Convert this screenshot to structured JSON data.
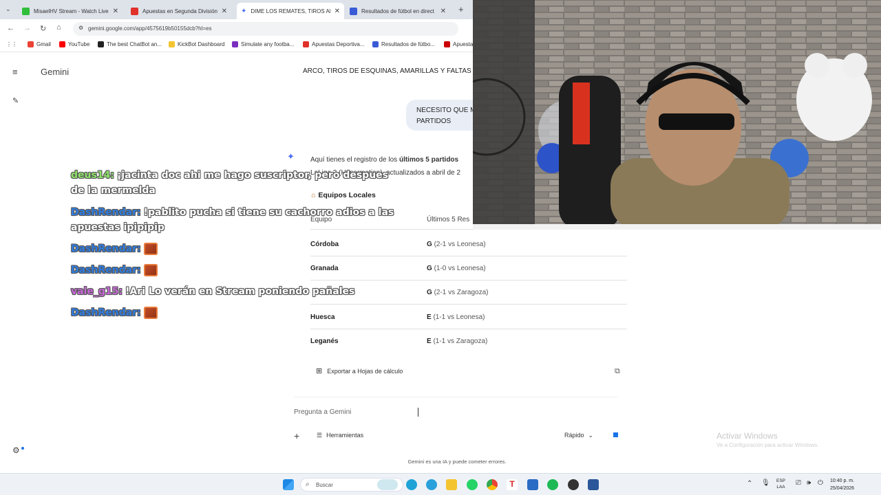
{
  "browser": {
    "tabs": [
      {
        "title": "MisaelHV Stream - Watch Live",
        "color": "#2fbf3a"
      },
      {
        "title": "Apuestas en Segunda División",
        "color": "#e0312b"
      },
      {
        "title": "DIME LOS REMATES, TIROS AL",
        "color": "#4b6ef5"
      },
      {
        "title": "Resultados de fútbol en direct",
        "color": "#3a5bd6"
      }
    ],
    "url": "gemini.google.com/app/4575619b50155dcb?hl=es",
    "bookmarks": [
      "Gmail",
      "YouTube",
      "The best ChatBot an...",
      "KickBot Dashboard",
      "Simulate any footba...",
      "Apuestas Deportiva...",
      "Resultados de fútbo...",
      "Apuesta"
    ]
  },
  "gemini": {
    "title": "Gemini",
    "prompt_strip": "ARCO, TIROS DE ESQUINAS, AMARILLAS Y FALTAS",
    "user_bubble": [
      "NECESITO QUE M",
      "PARTIDOS"
    ],
    "answer_intro_1": "Aquí tienes el registro de los ",
    "answer_intro_bold": "últimos 5 partidos",
    "answer_intro_2": "LaLiga 2 (Hypermotion), actualizados a abril de 2",
    "section_title": "Equipos Locales",
    "table_headers": [
      "Equipo",
      "Últimos 5 Res"
    ],
    "rows": [
      {
        "team": "Córdoba",
        "code": "G",
        "detail": "(2-1 vs Leonesa)"
      },
      {
        "team": "Granada",
        "code": "G",
        "detail": "(1-0 vs Leonesa)"
      },
      {
        "team": "",
        "code": "G",
        "detail": "(2-1 vs Zaragoza)"
      },
      {
        "team": "Huesca",
        "code": "E",
        "detail": "(1-1 vs Leonesa)"
      },
      {
        "team": "Leganés",
        "code": "E",
        "detail": "(1-1 vs Zaragoza)"
      }
    ],
    "export_label": "Exportar a Hojas de cálculo",
    "ask_placeholder": "Pregunta a Gemini",
    "tools_label": "Herramientas",
    "mode_label": "Rápido",
    "disclaimer": "Gemini es una IA y puede cometer errores."
  },
  "chat": [
    {
      "user": "deus14:",
      "color": "#8fe36a",
      "message": "¡jacinta doc ahi me hago suscriptor, pero despues de la mermelda"
    },
    {
      "user": "DashRendar:",
      "color": "#2f7de1",
      "message": "!pablito pucha si tiene su cachorro adios a las apuestas ipipipip"
    },
    {
      "user": "DashRendar:",
      "color": "#2f7de1",
      "message": ""
    },
    {
      "user": "DashRendar:",
      "color": "#2f7de1",
      "message": ""
    },
    {
      "user": "vale_g15:",
      "color": "#c86ad8",
      "message": "!Ari Lo verán en Stream poniendo pañales"
    },
    {
      "user": "DashRendar:",
      "color": "#2f7de1",
      "message": ""
    }
  ],
  "watermark": {
    "title": "Activar Windows",
    "subtitle": "Ve a Configuración para activar Windows."
  },
  "taskbar": {
    "search": "Buscar",
    "lang": [
      "ESP",
      "LAA"
    ],
    "time": "10:40 p. m.",
    "date": "25/04/2026"
  }
}
